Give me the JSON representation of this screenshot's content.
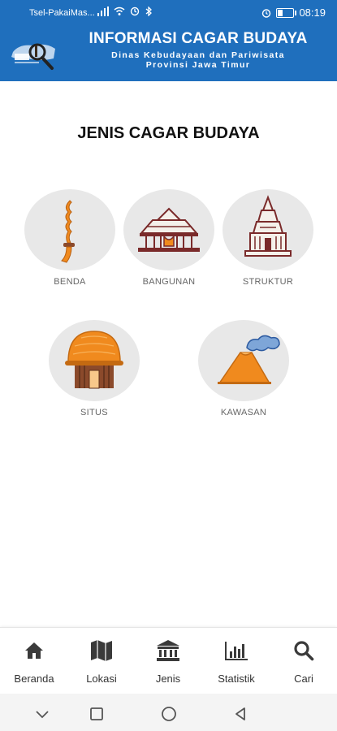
{
  "status_bar": {
    "carrier": "Tsel-PakaiMas...",
    "time": "08:19",
    "battery_level": 0.35
  },
  "header": {
    "title": "INFORMASI CAGAR BUDAYA",
    "subtitle_line1": "Dinas Kebudayaan dan Pariwisata",
    "subtitle_line2": "Provinsi Jawa Timur",
    "bg_color": "#1f6fbd"
  },
  "page": {
    "title": "JENIS CAGAR BUDAYA"
  },
  "categories": [
    {
      "label": "BENDA",
      "icon": "keris-icon"
    },
    {
      "label": "BANGUNAN",
      "icon": "pendopo-icon"
    },
    {
      "label": "STRUKTUR",
      "icon": "temple-icon"
    },
    {
      "label": "SITUS",
      "icon": "hut-icon"
    },
    {
      "label": "KAWASAN",
      "icon": "volcano-icon"
    }
  ],
  "bottom_nav": [
    {
      "label": "Beranda",
      "icon": "home-icon"
    },
    {
      "label": "Lokasi",
      "icon": "map-icon"
    },
    {
      "label": "Jenis",
      "icon": "bank-icon"
    },
    {
      "label": "Statistik",
      "icon": "bar-chart-icon"
    },
    {
      "label": "Cari",
      "icon": "search-icon"
    }
  ],
  "colors": {
    "circle_bg": "#e8e8e8",
    "orange": "#f08a1e",
    "brown": "#8b4a2b"
  }
}
